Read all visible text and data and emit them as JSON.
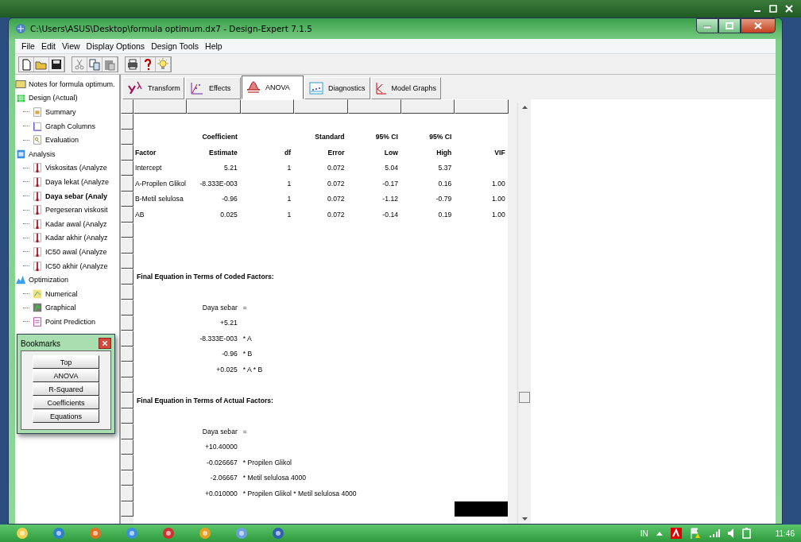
{
  "window": {
    "title": "C:\\Users\\ASUS\\Desktop\\formula optimum.dx7 - Design-Expert 7.1.5"
  },
  "menu": [
    "File",
    "Edit",
    "View",
    "Display Options",
    "Design Tools",
    "Help"
  ],
  "tree": [
    {
      "label": "Notes for formula optimum.",
      "kind": "folder",
      "selected": false
    },
    {
      "label": "Design (Actual)",
      "kind": "design",
      "selected": false,
      "children": [
        {
          "label": "Summary",
          "kind": "summary",
          "selected": false
        },
        {
          "label": "Graph Columns",
          "kind": "graph",
          "selected": false
        },
        {
          "label": "Evaluation",
          "kind": "evaluation",
          "selected": false
        }
      ]
    },
    {
      "label": "Analysis",
      "kind": "analysis",
      "selected": false,
      "children": [
        {
          "label": "Viskositas (Analyze",
          "kind": "response",
          "selected": false
        },
        {
          "label": "Daya lekat (Analyze",
          "kind": "response",
          "selected": false
        },
        {
          "label": "Daya sebar (Analy",
          "kind": "response",
          "selected": true
        },
        {
          "label": "Pergeseran viskosit",
          "kind": "response",
          "selected": false
        },
        {
          "label": "Kadar awal (Analyz",
          "kind": "response",
          "selected": false
        },
        {
          "label": "Kadar akhir (Analyz",
          "kind": "response",
          "selected": false
        },
        {
          "label": "IC50 awal (Analyze",
          "kind": "response",
          "selected": false
        },
        {
          "label": "IC50 akhir (Analyze",
          "kind": "response",
          "selected": false
        }
      ]
    },
    {
      "label": "Optimization",
      "kind": "optimization",
      "selected": false,
      "children": [
        {
          "label": "Numerical",
          "kind": "numerical",
          "selected": false
        },
        {
          "label": "Graphical",
          "kind": "graphical",
          "selected": false
        },
        {
          "label": "Point Prediction",
          "kind": "point",
          "selected": false
        }
      ]
    }
  ],
  "bookmarks": {
    "title": "Bookmarks",
    "buttons": [
      "Top",
      "ANOVA",
      "R-Squared",
      "Coefficients",
      "Equations"
    ]
  },
  "tabs": [
    {
      "label": "Transform",
      "kind": "transform",
      "selected": false
    },
    {
      "label": "Effects",
      "kind": "effects",
      "selected": false
    },
    {
      "label": "ANOVA",
      "kind": "anova",
      "selected": true
    },
    {
      "label": "Diagnostics",
      "kind": "diagnostics",
      "selected": false
    },
    {
      "label": "Model Graphs",
      "kind": "graphs",
      "selected": false
    }
  ],
  "coefficients": {
    "header_top": {
      "estimate": "Coefficient",
      "error": "Standard",
      "low": "95% CI",
      "high": "95% CI"
    },
    "header": [
      "Factor",
      "Estimate",
      "df",
      "Error",
      "Low",
      "High",
      "VIF"
    ],
    "rows": [
      [
        "Intercept",
        "5.21",
        "1",
        "0.072",
        "5.04",
        "5.37",
        null
      ],
      [
        "A-Propilen Glikol",
        "-8.333E-003",
        "1",
        "0.072",
        "-0.17",
        "0.16",
        "1.00"
      ],
      [
        "B-Metil selulosa",
        "-0.96",
        "1",
        "0.072",
        "-1.12",
        "-0.79",
        "1.00"
      ],
      [
        "AB",
        "0.025",
        "1",
        "0.072",
        "-0.14",
        "0.19",
        "1.00"
      ]
    ]
  },
  "equations": [
    {
      "title": "Final Equation in Terms of Coded Factors:",
      "response": "Daya sebar",
      "equals": "=",
      "terms": [
        {
          "coef": "+5.21"
        },
        {
          "coef": "-8.333E-003",
          "term": "* A"
        },
        {
          "coef": "-0.96",
          "term": "* B"
        },
        {
          "coef": "+0.025",
          "term": "* A * B"
        }
      ]
    },
    {
      "title": "Final Equation in Terms of Actual Factors:",
      "response": "Daya sebar",
      "equals": "=",
      "terms": [
        {
          "coef": "+10.40000"
        },
        {
          "coef": "-0.026667",
          "term": "* Propilen Glikol"
        },
        {
          "coef": "-2.06667",
          "term": "* Metil selulosa 4000"
        },
        {
          "coef": "+0.010000",
          "term": "* Propilen Glikol * Metil selulosa 4000"
        }
      ]
    }
  ],
  "taskbar": {
    "language": "IN",
    "clock": "11:46"
  }
}
